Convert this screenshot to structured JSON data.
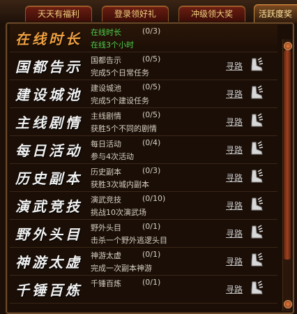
{
  "tabs": [
    {
      "label": "天天有福利"
    },
    {
      "label": "登录领好礼"
    },
    {
      "label": "冲级领大奖"
    },
    {
      "label": "活跃度奖"
    }
  ],
  "link_label": "寻路",
  "rows": [
    {
      "category": "在线时长",
      "title": "在线时长",
      "progress": "(0/3)",
      "desc": "在线3个小时"
    },
    {
      "category": "国都告示",
      "title": "国都告示",
      "progress": "(0/5)",
      "desc": "完成5个日常任务"
    },
    {
      "category": "建设城池",
      "title": "建设城池",
      "progress": "(0/5)",
      "desc": "完成5个建设任务"
    },
    {
      "category": "主线剧情",
      "title": "主线剧情",
      "progress": "(0/5)",
      "desc": "获胜5个不同的剧情"
    },
    {
      "category": "每日活动",
      "title": "每日活动",
      "progress": "(0/4)",
      "desc": "参与4次活动"
    },
    {
      "category": "历史副本",
      "title": "历史副本",
      "progress": "(0/3)",
      "desc": "获胜3次城内副本"
    },
    {
      "category": "演武竞技",
      "title": "演武竞技",
      "progress": "(0/10)",
      "desc": "挑战10次演武场"
    },
    {
      "category": "野外头目",
      "title": "野外头目",
      "progress": "(0/1)",
      "desc": "击杀一个野外逃逻头目"
    },
    {
      "category": "神游太虚",
      "title": "神游太虚",
      "progress": "(0/1)",
      "desc": "完成一次副本神游"
    },
    {
      "category": "千锤百炼",
      "title": "千锤百炼",
      "progress": "(0/1)",
      "desc": ""
    }
  ]
}
